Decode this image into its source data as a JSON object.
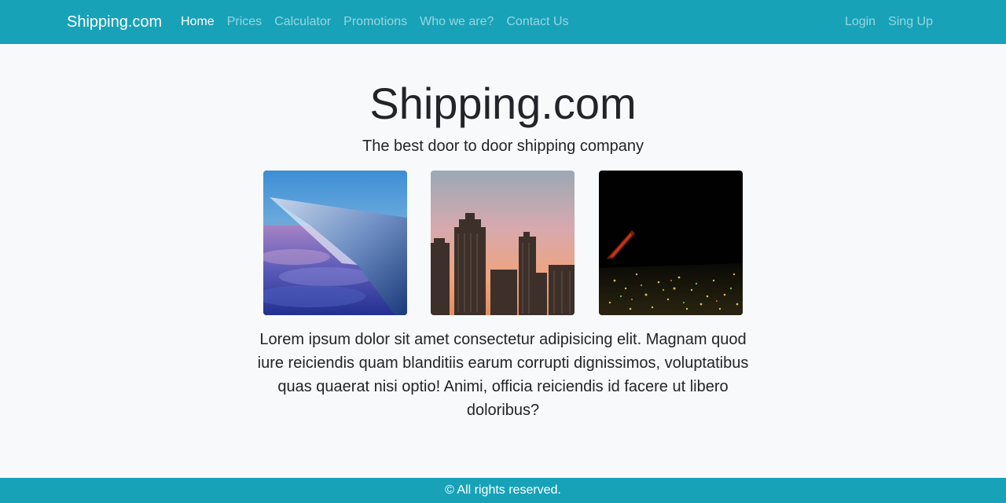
{
  "navbar": {
    "brand": "Shipping.com",
    "links": [
      {
        "label": "Home",
        "active": true
      },
      {
        "label": "Prices",
        "active": false
      },
      {
        "label": "Calculator",
        "active": false
      },
      {
        "label": "Promotions",
        "active": false
      },
      {
        "label": "Who we are?",
        "active": false
      },
      {
        "label": "Contact Us",
        "active": false
      }
    ],
    "auth": [
      {
        "label": "Login"
      },
      {
        "label": "Sing Up"
      }
    ],
    "color": "#17a2b8"
  },
  "hero": {
    "title": "Shipping.com",
    "tagline": "The best door to door shipping company"
  },
  "gallery": [
    {
      "name": "airplane-wing-sunset-photo"
    },
    {
      "name": "city-skyline-sunset-photo"
    },
    {
      "name": "night-city-lights-photo"
    }
  ],
  "body": {
    "text": "Lorem ipsum dolor sit amet consectetur adipisicing elit. Magnam quod iure reiciendis quam blanditiis earum corrupti dignissimos, voluptatibus quas quaerat nisi optio! Animi, officia reiciendis id facere ut libero doloribus?"
  },
  "footer": {
    "text": "© All rights reserved."
  }
}
